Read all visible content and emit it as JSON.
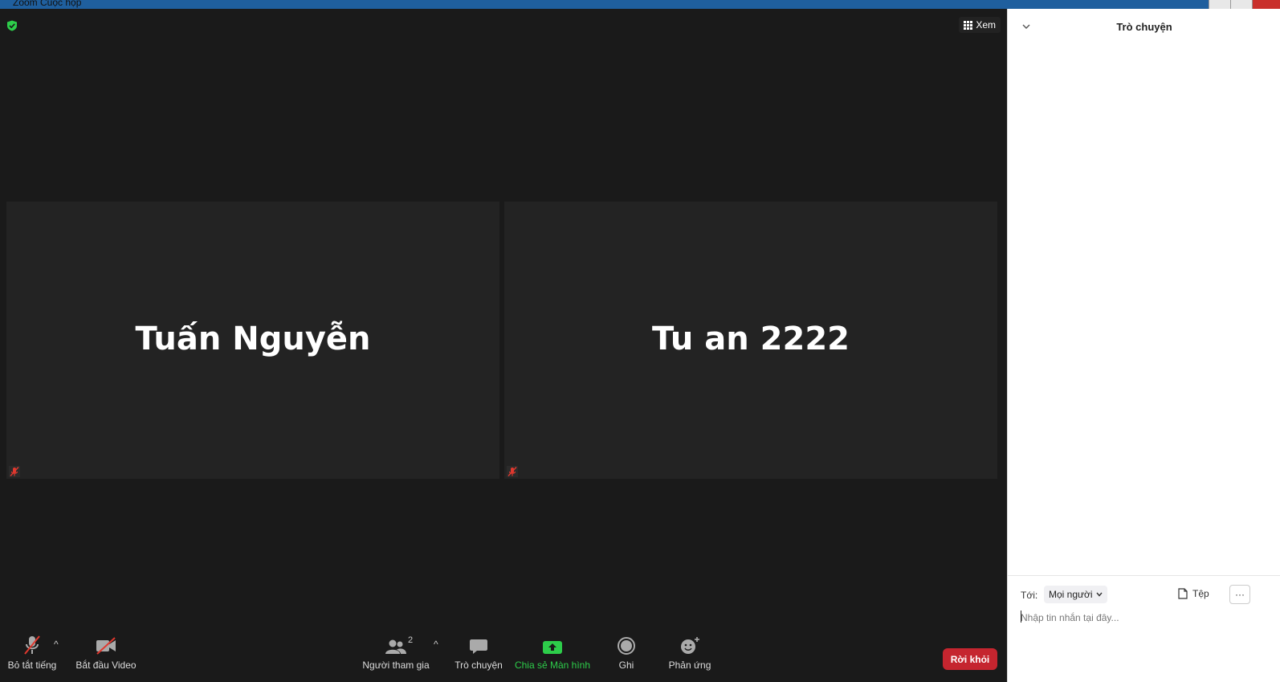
{
  "window": {
    "title": "Zoom Cuộc họp"
  },
  "meeting": {
    "view_label": "Xem",
    "participants": [
      {
        "name": "Tuấn Nguyễn",
        "muted": true
      },
      {
        "name": "Tu an 2222",
        "muted": true
      }
    ]
  },
  "toolbar": {
    "mute_label": "Bỏ tắt tiếng",
    "video_label": "Bắt đầu Video",
    "participants_label": "Người tham gia",
    "participants_count": "2",
    "chat_label": "Trò chuyện",
    "share_label": "Chia sẻ Màn hình",
    "record_label": "Ghi",
    "reactions_label": "Phản ứng",
    "leave_label": "Rời khỏi"
  },
  "chat": {
    "title": "Trò chuyện",
    "to_label": "Tới:",
    "recipient": "Mọi người",
    "file_label": "Tệp",
    "more_label": "···",
    "input_placeholder": "Nhập tin nhắn tại đây..."
  },
  "colors": {
    "leave": "#c5252f",
    "share": "#2dcd4a",
    "muted": "#e0382e",
    "shield": "#2dcd4a"
  }
}
